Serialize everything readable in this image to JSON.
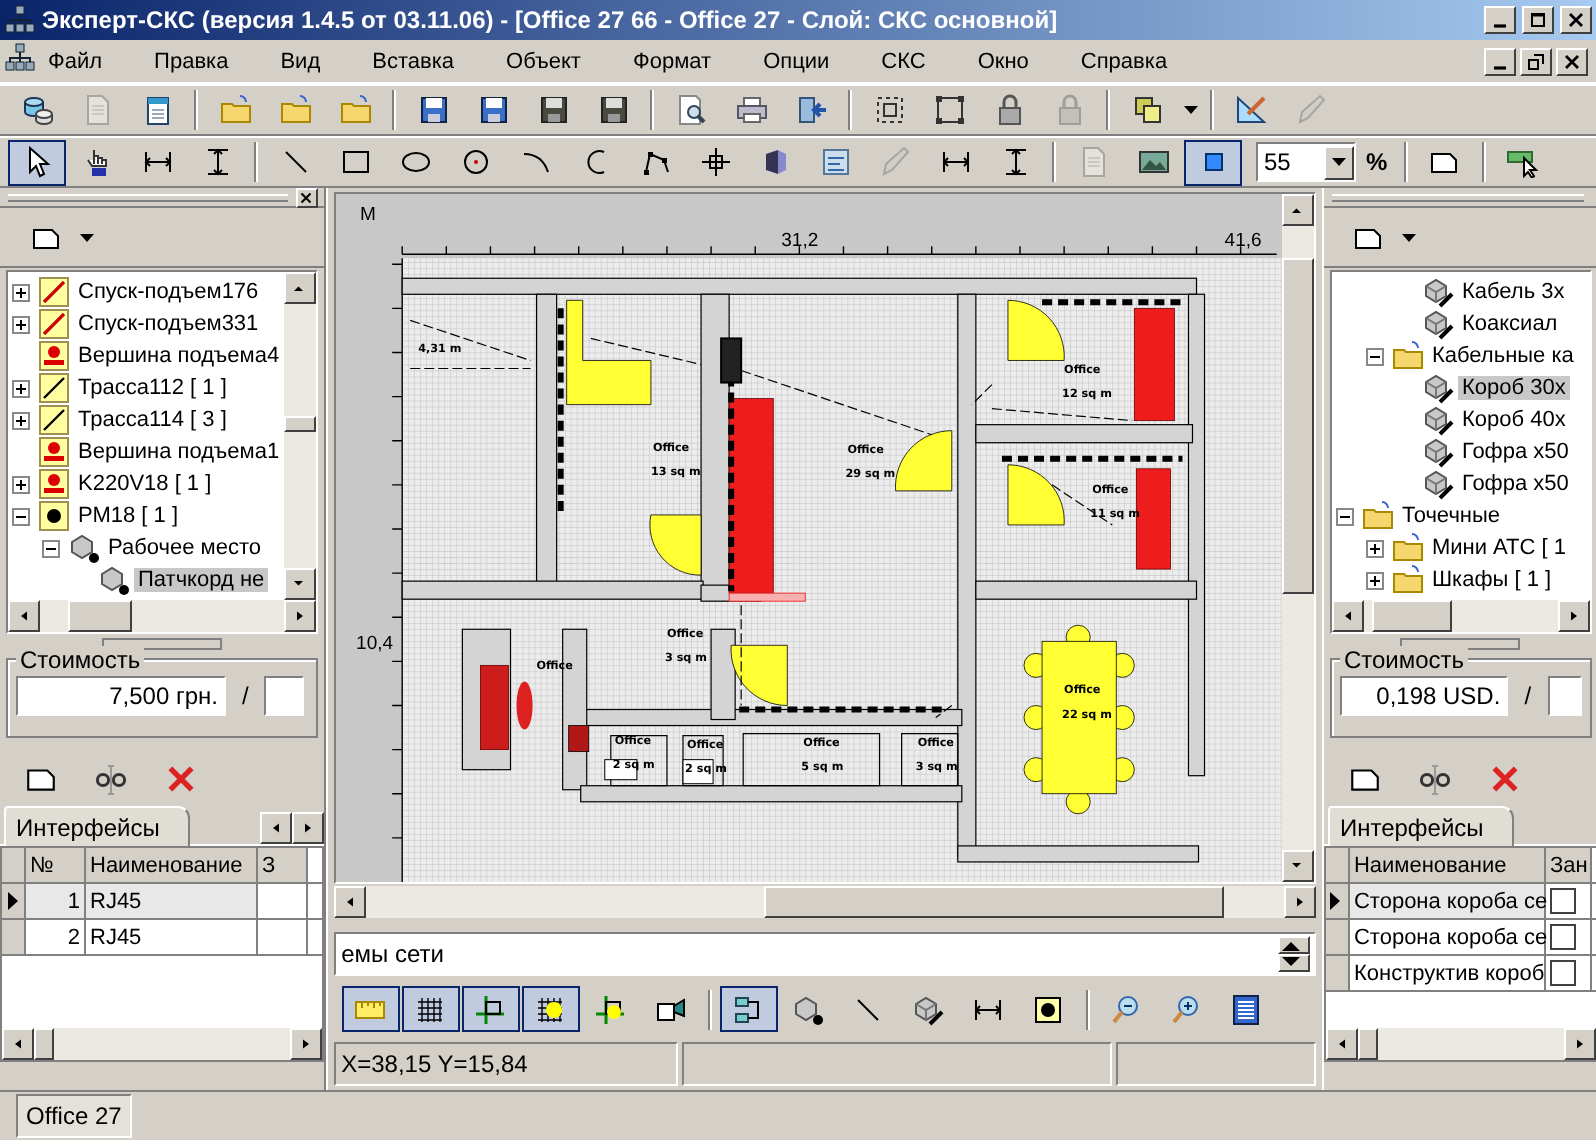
{
  "window": {
    "title": "Эксперт-СКС (версия 1.4.5 от 03.11.06) - [Office 27 66 - Office 27 - Слой: СКС основной]"
  },
  "menu": [
    "Файл",
    "Правка",
    "Вид",
    "Вставка",
    "Объект",
    "Формат",
    "Опции",
    "СКС",
    "Окно",
    "Справка"
  ],
  "toolbar_1": [
    {
      "kind": "database",
      "pressed": false,
      "disabled": false
    },
    {
      "kind": "document",
      "pressed": false,
      "disabled": true
    },
    {
      "kind": "notepad",
      "pressed": false,
      "disabled": false
    },
    {
      "kind": "separator"
    },
    {
      "kind": "folder",
      "pressed": false,
      "disabled": false
    },
    {
      "kind": "folder",
      "pressed": false,
      "disabled": false
    },
    {
      "kind": "folder",
      "pressed": false,
      "disabled": false
    },
    {
      "kind": "separator"
    },
    {
      "kind": "floppy",
      "pressed": false,
      "disabled": false
    },
    {
      "kind": "floppy",
      "pressed": false,
      "disabled": false
    },
    {
      "kind": "floppy-plain",
      "pressed": false,
      "disabled": false
    },
    {
      "kind": "floppy-plain",
      "pressed": false,
      "disabled": false
    },
    {
      "kind": "separator"
    },
    {
      "kind": "print-preview",
      "pressed": false,
      "disabled": false
    },
    {
      "kind": "printer",
      "pressed": false,
      "disabled": false
    },
    {
      "kind": "exit",
      "pressed": false,
      "disabled": false
    },
    {
      "kind": "separator"
    },
    {
      "kind": "group",
      "pressed": false,
      "disabled": false
    },
    {
      "kind": "ungroup",
      "pressed": false,
      "disabled": false
    },
    {
      "kind": "lock",
      "pressed": false,
      "disabled": false
    },
    {
      "kind": "lock",
      "pressed": false,
      "disabled": true
    },
    {
      "kind": "separator"
    },
    {
      "kind": "layers",
      "pressed": false,
      "disabled": false
    },
    {
      "kind": "dropdown"
    },
    {
      "kind": "separator"
    },
    {
      "kind": "ruler-pencil",
      "pressed": false,
      "disabled": false
    },
    {
      "kind": "pen",
      "pressed": false,
      "disabled": true
    }
  ],
  "toolbar_2": [
    {
      "kind": "pointer",
      "pressed": true,
      "disabled": false
    },
    {
      "kind": "hand",
      "pressed": false,
      "disabled": false
    },
    {
      "kind": "horizontal-dimension",
      "pressed": false,
      "disabled": false
    },
    {
      "kind": "vertical-dimension",
      "pressed": false,
      "disabled": false
    },
    {
      "kind": "separator"
    },
    {
      "kind": "line",
      "pressed": false,
      "disabled": false
    },
    {
      "kind": "rectangle",
      "pressed": false,
      "disabled": false
    },
    {
      "kind": "ellipse",
      "pressed": false,
      "disabled": false
    },
    {
      "kind": "circle-point",
      "pressed": false,
      "disabled": false
    },
    {
      "kind": "arc",
      "pressed": false,
      "disabled": false
    },
    {
      "kind": "open-arc",
      "pressed": false,
      "disabled": false
    },
    {
      "kind": "polyline",
      "pressed": false,
      "disabled": false
    },
    {
      "kind": "crosshair",
      "pressed": false,
      "disabled": false
    },
    {
      "kind": "block",
      "pressed": false,
      "disabled": false
    },
    {
      "kind": "format",
      "pressed": false,
      "disabled": false
    },
    {
      "kind": "pen",
      "pressed": false,
      "disabled": true
    },
    {
      "kind": "horizontal-dimension",
      "pressed": false,
      "disabled": false
    },
    {
      "kind": "vertical-dimension",
      "pressed": false,
      "disabled": false
    },
    {
      "kind": "separator"
    },
    {
      "kind": "document",
      "pressed": false,
      "disabled": true
    },
    {
      "kind": "image",
      "pressed": false,
      "disabled": false
    },
    {
      "kind": "square",
      "pressed": true,
      "disabled": false
    },
    {
      "kind": "zoom-combo",
      "value": "55"
    },
    {
      "kind": "unit",
      "text": "%"
    },
    {
      "kind": "separator"
    },
    {
      "kind": "page",
      "pressed": false,
      "disabled": false
    },
    {
      "kind": "separator"
    },
    {
      "kind": "pointer-plate",
      "pressed": false,
      "disabled": false
    }
  ],
  "left_panel": {
    "tree": [
      {
        "label": "Спуск-подъем176",
        "kind": "riser",
        "expanded": false,
        "selected": false
      },
      {
        "label": "Спуск-подъем331",
        "kind": "riser",
        "expanded": false,
        "selected": false
      },
      {
        "label": "Вершина подъема4",
        "kind": "vertex",
        "selected": false
      },
      {
        "label": "Трасса112  [ 1 ]",
        "kind": "route",
        "expanded": false,
        "selected": false
      },
      {
        "label": "Трасса114  [ 3 ]",
        "kind": "route",
        "expanded": false,
        "selected": false
      },
      {
        "label": "Вершина подъема1",
        "kind": "vertex",
        "selected": false
      },
      {
        "label": "K220V18  [ 1 ]",
        "kind": "vertex",
        "expanded": false,
        "selected": false
      },
      {
        "label": "РМ18  [ 1 ]",
        "kind": "node",
        "expanded": true,
        "selected": false,
        "children": [
          {
            "label": "Рабочее место",
            "kind": "cube-dot",
            "expanded": true,
            "selected": false,
            "children": [
              {
                "label": "Патчкорд не",
                "kind": "cube-dot",
                "selected": true
              }
            ]
          }
        ]
      }
    ],
    "cost": {
      "label": "Стоимость",
      "value": "7,500 грн.",
      "separator": "/"
    },
    "tabs": [
      {
        "label": "Интерфейсы",
        "selected": true
      }
    ],
    "table": {
      "columns": [
        "№",
        "Наименование",
        "З"
      ],
      "rows": [
        {
          "cells": [
            "1",
            "RJ45"
          ],
          "selected": true
        },
        {
          "cells": [
            "2",
            "RJ45"
          ],
          "selected": false
        }
      ]
    }
  },
  "canvas": {
    "ruler_labels": [
      "M",
      "31,2",
      "41,6",
      "10,4"
    ],
    "dimension": "4,31 m",
    "rooms": [
      {
        "name": "Office",
        "area": "13 sq m"
      },
      {
        "name": "Office",
        "area": "29 sq m"
      },
      {
        "name": "Office",
        "area": "12 sq m"
      },
      {
        "name": "Office",
        "area": "11 sq m"
      },
      {
        "name": "Office",
        "area": "3 sq m"
      },
      {
        "name": "Office",
        "area": "22 sq m"
      },
      {
        "name": "Office",
        "area": "2 sq m"
      },
      {
        "name": "Office",
        "area": "2 sq m"
      },
      {
        "name": "Office",
        "area": "5 sq m"
      },
      {
        "name": "Office",
        "area": "3 sq m"
      },
      {
        "name": "Office"
      }
    ]
  },
  "command_field": {
    "value": "емы сети"
  },
  "toolbar_3": [
    {
      "kind": "ruler",
      "pressed": true,
      "disabled": false
    },
    {
      "kind": "grid",
      "pressed": true,
      "disabled": false
    },
    {
      "kind": "snap-cross",
      "pressed": true,
      "disabled": false
    },
    {
      "kind": "grid-point",
      "pressed": true,
      "disabled": false
    },
    {
      "kind": "snap-point",
      "pressed": false,
      "disabled": false
    },
    {
      "kind": "camera",
      "pressed": false,
      "disabled": false
    },
    {
      "kind": "separator"
    },
    {
      "kind": "network",
      "pressed": true,
      "disabled": false
    },
    {
      "kind": "cube-dot",
      "pressed": false,
      "disabled": false
    },
    {
      "kind": "line",
      "pressed": false,
      "disabled": false
    },
    {
      "kind": "cube-cable",
      "pressed": false,
      "disabled": false
    },
    {
      "kind": "horizontal-dimension",
      "pressed": false,
      "disabled": false
    },
    {
      "kind": "dot-tile",
      "pressed": false,
      "disabled": false
    },
    {
      "kind": "separator"
    },
    {
      "kind": "zoom-out",
      "pressed": false,
      "disabled": false
    },
    {
      "kind": "zoom-in",
      "pressed": false,
      "disabled": false
    },
    {
      "kind": "list",
      "pressed": false,
      "disabled": false
    }
  ],
  "coordinates": "X=38,15  Y=15,84",
  "right_panel": {
    "tree": [
      {
        "children": [
          {
            "children": [
              {
                "label": "Кабель 3х",
                "kind": "cube-cable",
                "selected": false
              },
              {
                "label": "Коаксиал",
                "kind": "cube-cable",
                "selected": false
              }
            ]
          },
          {
            "label": "Кабельные ка",
            "kind": "folder",
            "expanded": true,
            "selected": false,
            "children": [
              {
                "label": "Короб 30х",
                "kind": "cube-cable",
                "selected": true
              },
              {
                "label": "Короб 40х",
                "kind": "cube-cable",
                "selected": false
              },
              {
                "label": "Гофра х50",
                "kind": "cube-cable",
                "selected": false
              },
              {
                "label": "Гофра х50",
                "kind": "cube-cable",
                "selected": false
              }
            ]
          }
        ]
      },
      {
        "label": "Точечные",
        "kind": "folder",
        "expanded": true,
        "selected": false,
        "children": [
          {
            "label": "Мини АТС  [ 1",
            "kind": "folder",
            "expanded": false,
            "selected": false
          },
          {
            "label": "Шкафы  [ 1 ]",
            "kind": "folder",
            "expanded": false,
            "selected": false
          }
        ]
      }
    ],
    "cost": {
      "label": "Стоимость",
      "value": "0,198 USD.",
      "separator": "/"
    },
    "tabs": [
      {
        "label": "Интерфейсы",
        "selected": true
      }
    ],
    "table": {
      "columns": [
        "Наименование",
        "Зан"
      ],
      "rows": [
        {
          "cells": [
            "Сторона короба се"
          ],
          "checked": false,
          "selected": true
        },
        {
          "cells": [
            "Сторона короба се"
          ],
          "checked": false,
          "selected": false
        },
        {
          "cells": [
            "Конструктив короб"
          ],
          "checked": false,
          "selected": false
        }
      ]
    }
  },
  "status_bar": {
    "tabs": [
      {
        "label": "Office 27",
        "selected": true
      }
    ]
  }
}
